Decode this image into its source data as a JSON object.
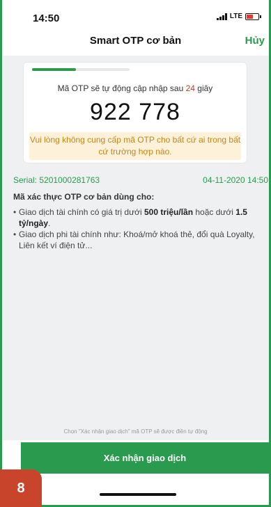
{
  "status_bar": {
    "time": "14:50",
    "network": "LTE"
  },
  "nav": {
    "title": "Smart OTP cơ bản",
    "cancel_label": "Hủy"
  },
  "otp": {
    "progress": 0.45,
    "info_prefix": "Mã OTP sẽ tự động cập nhập sau ",
    "seconds": "24",
    "info_suffix": " giây",
    "code": "922 778",
    "warning": "Vui lòng không cung cấp mã OTP cho bất cứ ai trong bất cứ trường hợp nào."
  },
  "meta": {
    "serial": "Serial: 5201000281763",
    "datetime": "04-11-2020 14:50"
  },
  "description": {
    "heading": "Mã xác thực OTP cơ bản dùng cho:",
    "item1_a": "Giao dịch tài chính có giá trị dưới ",
    "item1_b": "500 triệu/lần",
    "item1_c": " hoặc dưới ",
    "item1_d": "1.5 tỷ/ngày",
    "item1_e": ".",
    "item2": "Giao dịch phi tài chính như: Khoá/mở khoá thẻ, đổi quà Loyalty, Liên kết ví điện tử..."
  },
  "hint": "Chọn \"Xác nhận giao dịch\" mã OTP sẽ được điền tự động",
  "confirm_label": "Xác nhận giao dịch",
  "badge": "8",
  "colors": {
    "brand_green": "#2a9b4e",
    "warning_bg": "#fdf2d9",
    "warning_text": "#c0861a",
    "badge": "#c8442b"
  }
}
